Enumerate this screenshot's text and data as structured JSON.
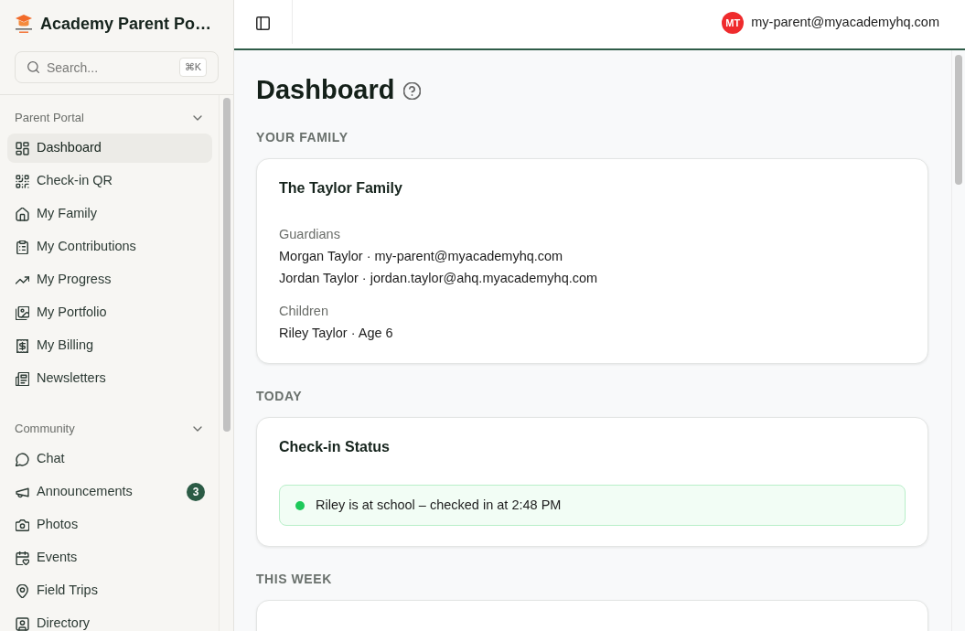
{
  "sidebar": {
    "title": "Academy Parent Po…",
    "search": {
      "placeholder": "Search...",
      "shortcut": "⌘K"
    },
    "nav_groups": [
      {
        "label": "Parent Portal",
        "expanded": true,
        "items": [
          {
            "label": "Dashboard",
            "selected": true
          },
          {
            "label": "Check-in QR",
            "selected": false
          },
          {
            "label": "My Family",
            "selected": false
          },
          {
            "label": "My Contributions",
            "selected": false
          },
          {
            "label": "My Progress",
            "selected": false
          },
          {
            "label": "My Portfolio",
            "selected": false
          },
          {
            "label": "My Billing",
            "selected": false
          },
          {
            "label": "Newsletters",
            "selected": false
          }
        ]
      },
      {
        "label": "Community",
        "expanded": true,
        "items": [
          {
            "label": "Chat",
            "selected": false
          },
          {
            "label": "Announcements",
            "selected": false,
            "badge": "3"
          },
          {
            "label": "Photos",
            "selected": false
          },
          {
            "label": "Events",
            "selected": false
          },
          {
            "label": "Field Trips",
            "selected": false
          },
          {
            "label": "Directory",
            "selected": false
          }
        ]
      }
    ]
  },
  "topbar": {
    "user": {
      "initials": "MT",
      "email": "my-parent@myacademyhq.com"
    }
  },
  "page": {
    "title": "Dashboard",
    "sections": [
      {
        "heading": "YOUR FAMILY",
        "kind": "family",
        "title": "The Taylor Family",
        "groups": [
          {
            "label": "Guardians",
            "lines": [
              "Morgan Taylor · my-parent@myacademyhq.com",
              "Jordan Taylor · jordan.taylor@ahq.myacademyhq.com"
            ]
          },
          {
            "label": "Children",
            "lines": [
              "Riley Taylor · Age 6"
            ]
          }
        ]
      },
      {
        "heading": "TODAY",
        "kind": "status",
        "title": "Check-in Status",
        "status": {
          "text": "Riley is at school – checked in at 2:48 PM",
          "checked_in": true
        }
      },
      {
        "heading": "THIS WEEK"
      }
    ]
  }
}
